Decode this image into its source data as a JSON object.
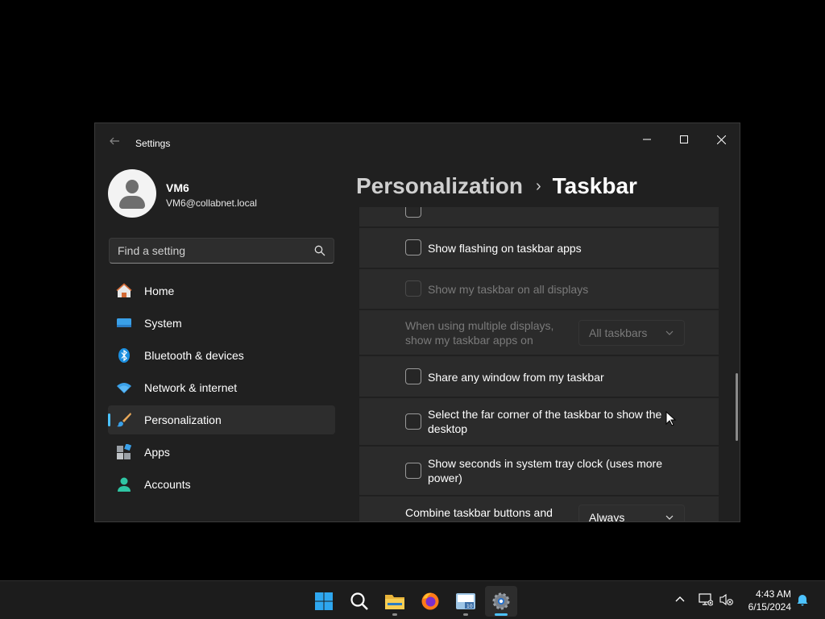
{
  "window": {
    "title": "Settings",
    "controls": {
      "minimize": "minimize",
      "maximize": "maximize",
      "close": "close"
    }
  },
  "profile": {
    "name": "VM6",
    "email": "VM6@collabnet.local"
  },
  "search": {
    "placeholder": "Find a setting"
  },
  "nav": {
    "items": [
      {
        "label": "Home",
        "icon": "home-icon"
      },
      {
        "label": "System",
        "icon": "system-icon"
      },
      {
        "label": "Bluetooth & devices",
        "icon": "bluetooth-icon"
      },
      {
        "label": "Network & internet",
        "icon": "network-icon"
      },
      {
        "label": "Personalization",
        "icon": "paintbrush-icon",
        "selected": true
      },
      {
        "label": "Apps",
        "icon": "apps-icon"
      },
      {
        "label": "Accounts",
        "icon": "accounts-icon"
      }
    ]
  },
  "breadcrumb": {
    "parent": "Personalization",
    "separator": "›",
    "current": "Taskbar"
  },
  "settings": {
    "flashing": {
      "label": "Show flashing on taskbar apps",
      "checked": false
    },
    "all_displays": {
      "label": "Show my taskbar on all displays",
      "checked": false,
      "disabled": true
    },
    "multi_display": {
      "label": "When using multiple displays, show my taskbar apps on",
      "value": "All taskbars",
      "disabled": true
    },
    "share_window": {
      "label": "Share any window from my taskbar",
      "checked": false
    },
    "far_corner": {
      "label": "Select the far corner of the taskbar to show the desktop",
      "checked": false
    },
    "seconds": {
      "label": "Show seconds in system tray clock (uses more power)",
      "checked": false
    },
    "combine": {
      "label": "Combine taskbar buttons and",
      "value": "Always"
    }
  },
  "taskbar": {
    "apps": [
      "start-icon",
      "search-icon",
      "file-explorer-icon",
      "firefox-icon",
      "app-icon",
      "settings-icon"
    ],
    "clock": {
      "time": "4:43 AM",
      "date": "6/15/2024"
    }
  },
  "colors": {
    "accent": "#4cc2ff",
    "window_bg": "#202020",
    "card_bg": "#2b2b2b",
    "taskbar_bg": "#1c1c1c"
  }
}
